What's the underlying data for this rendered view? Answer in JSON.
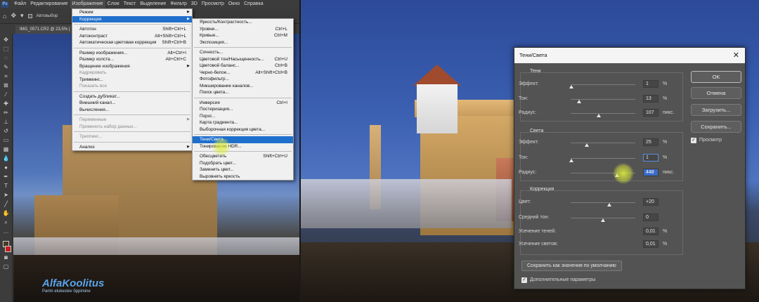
{
  "menubar": {
    "items": [
      "Файл",
      "Редактирование",
      "Изображение",
      "Слои",
      "Текст",
      "Выделение",
      "Фильтр",
      "3D",
      "Просмотр",
      "Окно",
      "Справка"
    ],
    "active_index": 2
  },
  "options_bar": {
    "autoselect_label": "Автовыбор"
  },
  "document_tab": {
    "title": "IMG_0571.CR2 @ 23,5% ("
  },
  "image_menu": {
    "rows": [
      {
        "label": "Режим",
        "shortcut": "",
        "submenu": true,
        "disabled": false
      },
      {
        "label": "Коррекция",
        "shortcut": "",
        "submenu": true,
        "disabled": false,
        "highlighted": true
      },
      {
        "sep": true
      },
      {
        "label": "Автотон",
        "shortcut": "Shift+Ctrl+L",
        "disabled": false
      },
      {
        "label": "Автоконтраст",
        "shortcut": "Alt+Shift+Ctrl+L",
        "disabled": false
      },
      {
        "label": "Автоматическая цветовая коррекция",
        "shortcut": "Shift+Ctrl+B",
        "disabled": false
      },
      {
        "sep": true
      },
      {
        "label": "Размер изображения...",
        "shortcut": "Alt+Ctrl+I",
        "disabled": false
      },
      {
        "label": "Размер холста...",
        "shortcut": "Alt+Ctrl+C",
        "disabled": false
      },
      {
        "label": "Вращение изображения",
        "shortcut": "",
        "submenu": true,
        "disabled": false
      },
      {
        "label": "Кадрировать",
        "shortcut": "",
        "disabled": true
      },
      {
        "label": "Тримминг...",
        "shortcut": "",
        "disabled": false
      },
      {
        "label": "Показать все",
        "shortcut": "",
        "disabled": true
      },
      {
        "sep": true
      },
      {
        "label": "Создать дубликат...",
        "shortcut": "",
        "disabled": false
      },
      {
        "label": "Внешний канал...",
        "shortcut": "",
        "disabled": false
      },
      {
        "label": "Вычисления...",
        "shortcut": "",
        "disabled": false
      },
      {
        "sep": true
      },
      {
        "label": "Переменные",
        "shortcut": "",
        "submenu": true,
        "disabled": true
      },
      {
        "label": "Применить набор данных...",
        "shortcut": "",
        "disabled": true
      },
      {
        "sep": true
      },
      {
        "label": "Треппинг...",
        "shortcut": "",
        "disabled": true
      },
      {
        "sep": true
      },
      {
        "label": "Анализ",
        "shortcut": "",
        "submenu": true,
        "disabled": false
      }
    ]
  },
  "adjust_menu": {
    "rows": [
      {
        "label": "Яркость/Контрастность...",
        "shortcut": ""
      },
      {
        "label": "Уровни...",
        "shortcut": "Ctrl+L"
      },
      {
        "label": "Кривые...",
        "shortcut": "Ctrl+M"
      },
      {
        "label": "Экспозиция...",
        "shortcut": ""
      },
      {
        "sep": true
      },
      {
        "label": "Сочность...",
        "shortcut": ""
      },
      {
        "label": "Цветовой тон/Насыщенность...",
        "shortcut": "Ctrl+U"
      },
      {
        "label": "Цветовой баланс...",
        "shortcut": "Ctrl+B"
      },
      {
        "label": "Черно-белое...",
        "shortcut": "Alt+Shift+Ctrl+B"
      },
      {
        "label": "Фотофильтр...",
        "shortcut": ""
      },
      {
        "label": "Микширование каналов...",
        "shortcut": ""
      },
      {
        "label": "Поиск цвета...",
        "shortcut": ""
      },
      {
        "sep": true
      },
      {
        "label": "Инверсия",
        "shortcut": "Ctrl+I"
      },
      {
        "label": "Постеризация...",
        "shortcut": ""
      },
      {
        "label": "Порог...",
        "shortcut": ""
      },
      {
        "label": "Карта градиента...",
        "shortcut": ""
      },
      {
        "label": "Выборочная коррекция цвета...",
        "shortcut": ""
      },
      {
        "sep": true
      },
      {
        "label": "Тени/Света...",
        "shortcut": "",
        "highlighted": true
      },
      {
        "label": "Тонирование HDR...",
        "shortcut": ""
      },
      {
        "sep": true
      },
      {
        "label": "Обесцветить",
        "shortcut": "Shift+Ctrl+U"
      },
      {
        "label": "Подобрать цвет...",
        "shortcut": ""
      },
      {
        "label": "Заменить цвет...",
        "shortcut": ""
      },
      {
        "label": "Выровнять яркость",
        "shortcut": ""
      }
    ]
  },
  "dialog": {
    "title": "Тени/Света",
    "shadows": {
      "title": "Тени",
      "effect": {
        "label": "Эффект:",
        "value": "1",
        "unit": "%",
        "level": 0.01
      },
      "tone": {
        "label": "Тон:",
        "value": "13",
        "unit": "%",
        "level": 0.13
      },
      "radius": {
        "label": "Радиус:",
        "value": "107",
        "unit": "пикс.",
        "level": 0.43
      }
    },
    "highlights": {
      "title": "Света",
      "effect": {
        "label": "Эффект:",
        "value": "25",
        "unit": "%",
        "level": 0.25
      },
      "tone": {
        "label": "Тон:",
        "value": "1",
        "unit": "%",
        "level": 0.01
      },
      "radius": {
        "label": "Радиус:",
        "value": "448",
        "unit": "пикс.",
        "level": 0.72
      }
    },
    "correction": {
      "title": "Коррекция",
      "color": {
        "label": "Цвет:",
        "value": "+20",
        "level": 0.6
      },
      "midtone": {
        "label": "Средний тон:",
        "value": "0",
        "level": 0.5
      },
      "clip_shadows": {
        "label": "Усечение теней:",
        "value": "0,01",
        "unit": "%"
      },
      "clip_highlights": {
        "label": "Усечение светов:",
        "value": "0,01",
        "unit": "%"
      }
    },
    "buttons": {
      "ok": "OK",
      "cancel": "Отмена",
      "load": "Загрузить...",
      "save": "Сохранить..."
    },
    "preview_label": "Просмотр",
    "save_defaults": "Сохранить как значения по умолчанию",
    "more_options": "Дополнительные параметры"
  },
  "logo": {
    "title": "AlfaKoolitus",
    "subtitle": "Parim elukestev õppimine"
  },
  "colors": {
    "fg_swatch": "#4a3a24",
    "bg_swatch": "#c81e1e",
    "menu_highlight": "#1f6fcc",
    "dialog_bg": "#535353"
  }
}
